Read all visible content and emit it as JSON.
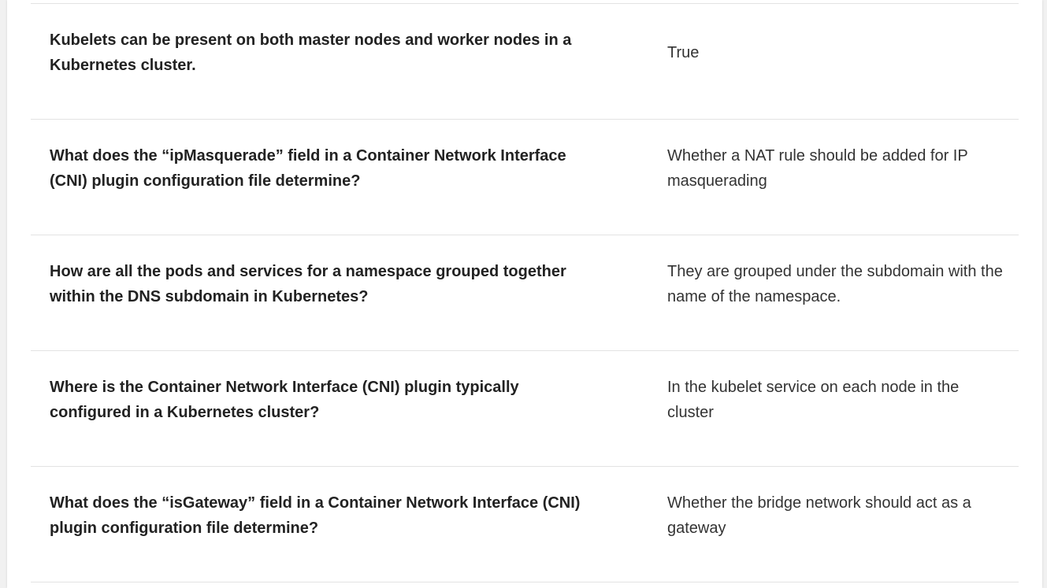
{
  "flashcards": [
    {
      "question": "Kubelets can be present on both master nodes and worker nodes in a Kubernetes cluster.",
      "answer": "True"
    },
    {
      "question": "What does the “ipMasquerade” field in a Container Network Interface (CNI) plugin configuration file determine?",
      "answer": "Whether a NAT rule should be added for IP masquerading"
    },
    {
      "question": "How are all the pods and services for a namespace grouped together within the DNS subdomain in Kubernetes?",
      "answer": "They are grouped under the subdomain with the name of the namespace."
    },
    {
      "question": "Where is the Container Network Interface (CNI) plugin typically configured in a Kubernetes cluster?",
      "answer": "In the kubelet service on each node in the cluster"
    },
    {
      "question": "What does the “isGateway” field in a Container Network Interface (CNI) plugin configuration file determine?",
      "answer": "Whether the bridge network should act as a gateway"
    }
  ]
}
